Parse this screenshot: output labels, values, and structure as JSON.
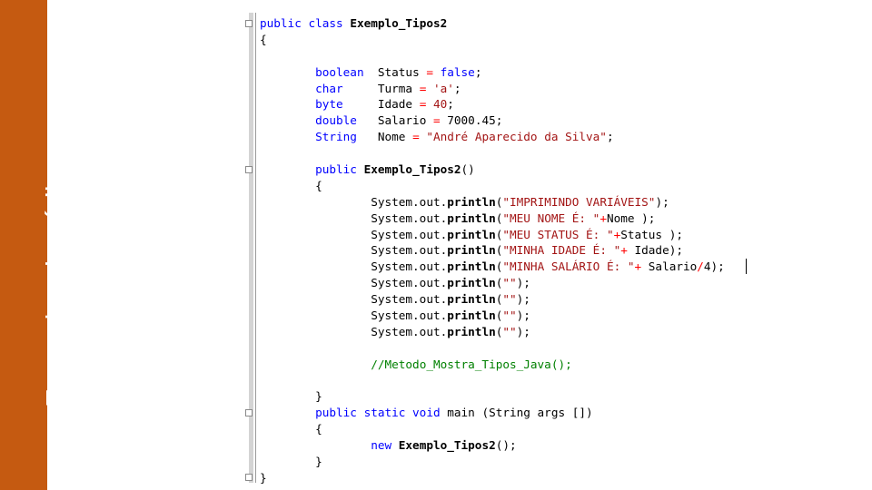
{
  "sidebar": {
    "title": "Exemplos de códigos",
    "color": "#c55a11"
  },
  "colors": {
    "keyword": "#0000ff",
    "string": "#a31515",
    "operator": "#ff0000",
    "comment": "#008000",
    "text": "#000000"
  },
  "code_lines": [
    [
      {
        "t": "kw",
        "v": "public class "
      },
      {
        "t": "bold",
        "v": "Exemplo_Tipos2"
      }
    ],
    [
      {
        "t": "id",
        "v": "{"
      }
    ],
    [],
    [
      {
        "t": "id",
        "v": "        "
      },
      {
        "t": "kw",
        "v": "boolean"
      },
      {
        "t": "id",
        "v": "  Status "
      },
      {
        "t": "op",
        "v": "="
      },
      {
        "t": "id",
        "v": " "
      },
      {
        "t": "kw",
        "v": "false"
      },
      {
        "t": "id",
        "v": ";"
      }
    ],
    [
      {
        "t": "id",
        "v": "        "
      },
      {
        "t": "kw",
        "v": "char"
      },
      {
        "t": "id",
        "v": "     Turma "
      },
      {
        "t": "op",
        "v": "="
      },
      {
        "t": "id",
        "v": " "
      },
      {
        "t": "str",
        "v": "'a'"
      },
      {
        "t": "id",
        "v": ";"
      }
    ],
    [
      {
        "t": "id",
        "v": "        "
      },
      {
        "t": "kw",
        "v": "byte"
      },
      {
        "t": "id",
        "v": "     Idade "
      },
      {
        "t": "op",
        "v": "="
      },
      {
        "t": "id",
        "v": " "
      },
      {
        "t": "str",
        "v": "40"
      },
      {
        "t": "id",
        "v": ";"
      }
    ],
    [
      {
        "t": "id",
        "v": "        "
      },
      {
        "t": "kw",
        "v": "double"
      },
      {
        "t": "id",
        "v": "   Salario "
      },
      {
        "t": "op",
        "v": "="
      },
      {
        "t": "id",
        "v": " 7000.45;"
      }
    ],
    [
      {
        "t": "id",
        "v": "        "
      },
      {
        "t": "kw",
        "v": "String"
      },
      {
        "t": "id",
        "v": "   Nome "
      },
      {
        "t": "op",
        "v": "="
      },
      {
        "t": "id",
        "v": " "
      },
      {
        "t": "str",
        "v": "\"André Aparecido da Silva\""
      },
      {
        "t": "id",
        "v": ";"
      }
    ],
    [],
    [
      {
        "t": "id",
        "v": "        "
      },
      {
        "t": "kw",
        "v": "public"
      },
      {
        "t": "id",
        "v": " "
      },
      {
        "t": "bold",
        "v": "Exemplo_Tipos2"
      },
      {
        "t": "id",
        "v": "()"
      }
    ],
    [
      {
        "t": "id",
        "v": "        {"
      }
    ],
    [
      {
        "t": "id",
        "v": "                System.out."
      },
      {
        "t": "bold",
        "v": "println"
      },
      {
        "t": "id",
        "v": "("
      },
      {
        "t": "str",
        "v": "\"IMPRIMINDO VARIÁVEIS\""
      },
      {
        "t": "id",
        "v": ");"
      }
    ],
    [
      {
        "t": "id",
        "v": "                System.out."
      },
      {
        "t": "bold",
        "v": "println"
      },
      {
        "t": "id",
        "v": "("
      },
      {
        "t": "str",
        "v": "\"MEU NOME É: \""
      },
      {
        "t": "op",
        "v": "+"
      },
      {
        "t": "id",
        "v": "Nome );"
      }
    ],
    [
      {
        "t": "id",
        "v": "                System.out."
      },
      {
        "t": "bold",
        "v": "println"
      },
      {
        "t": "id",
        "v": "("
      },
      {
        "t": "str",
        "v": "\"MEU STATUS É: \""
      },
      {
        "t": "op",
        "v": "+"
      },
      {
        "t": "id",
        "v": "Status );"
      }
    ],
    [
      {
        "t": "id",
        "v": "                System.out."
      },
      {
        "t": "bold",
        "v": "println"
      },
      {
        "t": "id",
        "v": "("
      },
      {
        "t": "str",
        "v": "\"MINHA IDADE É: \""
      },
      {
        "t": "op",
        "v": "+"
      },
      {
        "t": "id",
        "v": " Idade);"
      }
    ],
    [
      {
        "t": "id",
        "v": "                System.out."
      },
      {
        "t": "bold",
        "v": "println"
      },
      {
        "t": "id",
        "v": "("
      },
      {
        "t": "str",
        "v": "\"MINHA SALÁRIO É: \""
      },
      {
        "t": "op",
        "v": "+"
      },
      {
        "t": "id",
        "v": " Salario"
      },
      {
        "t": "op",
        "v": "/"
      },
      {
        "t": "id",
        "v": "4);"
      }
    ],
    [
      {
        "t": "id",
        "v": "                System.out."
      },
      {
        "t": "bold",
        "v": "println"
      },
      {
        "t": "id",
        "v": "("
      },
      {
        "t": "str",
        "v": "\"\""
      },
      {
        "t": "id",
        "v": ");"
      }
    ],
    [
      {
        "t": "id",
        "v": "                System.out."
      },
      {
        "t": "bold",
        "v": "println"
      },
      {
        "t": "id",
        "v": "("
      },
      {
        "t": "str",
        "v": "\"\""
      },
      {
        "t": "id",
        "v": ");"
      }
    ],
    [
      {
        "t": "id",
        "v": "                System.out."
      },
      {
        "t": "bold",
        "v": "println"
      },
      {
        "t": "id",
        "v": "("
      },
      {
        "t": "str",
        "v": "\"\""
      },
      {
        "t": "id",
        "v": ");"
      }
    ],
    [
      {
        "t": "id",
        "v": "                System.out."
      },
      {
        "t": "bold",
        "v": "println"
      },
      {
        "t": "id",
        "v": "("
      },
      {
        "t": "str",
        "v": "\"\""
      },
      {
        "t": "id",
        "v": ");"
      }
    ],
    [],
    [
      {
        "t": "id",
        "v": "                "
      },
      {
        "t": "cm",
        "v": "//Metodo_Mostra_Tipos_Java();"
      }
    ],
    [],
    [
      {
        "t": "id",
        "v": "        }"
      }
    ],
    [
      {
        "t": "id",
        "v": "        "
      },
      {
        "t": "kw",
        "v": "public static void"
      },
      {
        "t": "id",
        "v": " main (String args [])"
      }
    ],
    [
      {
        "t": "id",
        "v": "        {"
      }
    ],
    [
      {
        "t": "id",
        "v": "                "
      },
      {
        "t": "kw",
        "v": "new"
      },
      {
        "t": "id",
        "v": " "
      },
      {
        "t": "bold",
        "v": "Exemplo_Tipos2"
      },
      {
        "t": "id",
        "v": "();"
      }
    ],
    [
      {
        "t": "id",
        "v": "        }"
      }
    ],
    [
      {
        "t": "id",
        "v": "}"
      }
    ]
  ]
}
